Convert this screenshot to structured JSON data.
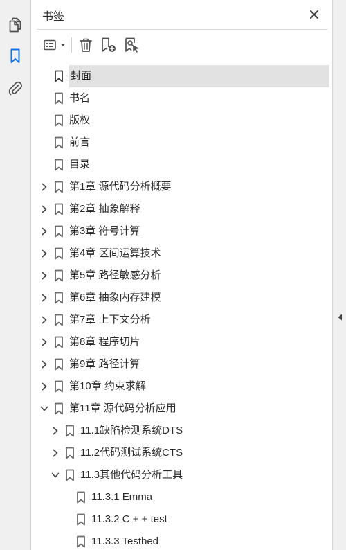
{
  "panel": {
    "title": "书签"
  },
  "rail": {
    "items": [
      {
        "name": "page-thumbnails",
        "icon": "copy-pages-icon",
        "active": false
      },
      {
        "name": "bookmarks",
        "icon": "bookmark-icon",
        "active": true
      },
      {
        "name": "attachments",
        "icon": "paperclip-icon",
        "active": false
      }
    ]
  },
  "toolbar": {
    "options_icon": "list-options-icon",
    "delete_icon": "trash-icon",
    "new_bookmark_icon": "add-bookmark-icon",
    "from_structure_icon": "bookmark-search-icon"
  },
  "colors": {
    "accent": "#1473e6",
    "selected_bg": "#e2e2e2",
    "icon": "#505050",
    "rail_bg": "#f0f0f0"
  },
  "bookmarks": [
    {
      "label": "封面",
      "level": 0,
      "expander": "none",
      "selected": true
    },
    {
      "label": "书名",
      "level": 0,
      "expander": "none",
      "selected": false
    },
    {
      "label": "版权",
      "level": 0,
      "expander": "none",
      "selected": false
    },
    {
      "label": "前言",
      "level": 0,
      "expander": "none",
      "selected": false
    },
    {
      "label": "目录",
      "level": 0,
      "expander": "none",
      "selected": false
    },
    {
      "label": "第1章  源代码分析概要",
      "level": 0,
      "expander": "collapsed",
      "selected": false
    },
    {
      "label": "第2章  抽象解释",
      "level": 0,
      "expander": "collapsed",
      "selected": false
    },
    {
      "label": "第3章  符号计算",
      "level": 0,
      "expander": "collapsed",
      "selected": false
    },
    {
      "label": "第4章  区间运算技术",
      "level": 0,
      "expander": "collapsed",
      "selected": false
    },
    {
      "label": "第5章  路径敏感分析",
      "level": 0,
      "expander": "collapsed",
      "selected": false
    },
    {
      "label": "第6章  抽象内存建模",
      "level": 0,
      "expander": "collapsed",
      "selected": false
    },
    {
      "label": "第7章  上下文分析",
      "level": 0,
      "expander": "collapsed",
      "selected": false
    },
    {
      "label": "第8章  程序切片",
      "level": 0,
      "expander": "collapsed",
      "selected": false
    },
    {
      "label": "第9章  路径计算",
      "level": 0,
      "expander": "collapsed",
      "selected": false
    },
    {
      "label": "第10章  约束求解",
      "level": 0,
      "expander": "collapsed",
      "selected": false
    },
    {
      "label": "第11章  源代码分析应用",
      "level": 0,
      "expander": "expanded",
      "selected": false
    },
    {
      "label": "11.1缺陷检测系统DTS",
      "level": 1,
      "expander": "collapsed",
      "selected": false
    },
    {
      "label": "11.2代码测试系统CTS",
      "level": 1,
      "expander": "collapsed",
      "selected": false
    },
    {
      "label": "11.3其他代码分析工具",
      "level": 1,
      "expander": "expanded",
      "selected": false
    },
    {
      "label": "11.3.1 Emma",
      "level": 2,
      "expander": "none",
      "selected": false
    },
    {
      "label": "11.3.2  C +  + test",
      "level": 2,
      "expander": "none",
      "selected": false
    },
    {
      "label": "11.3.3  Testbed",
      "level": 2,
      "expander": "none",
      "selected": false
    }
  ]
}
